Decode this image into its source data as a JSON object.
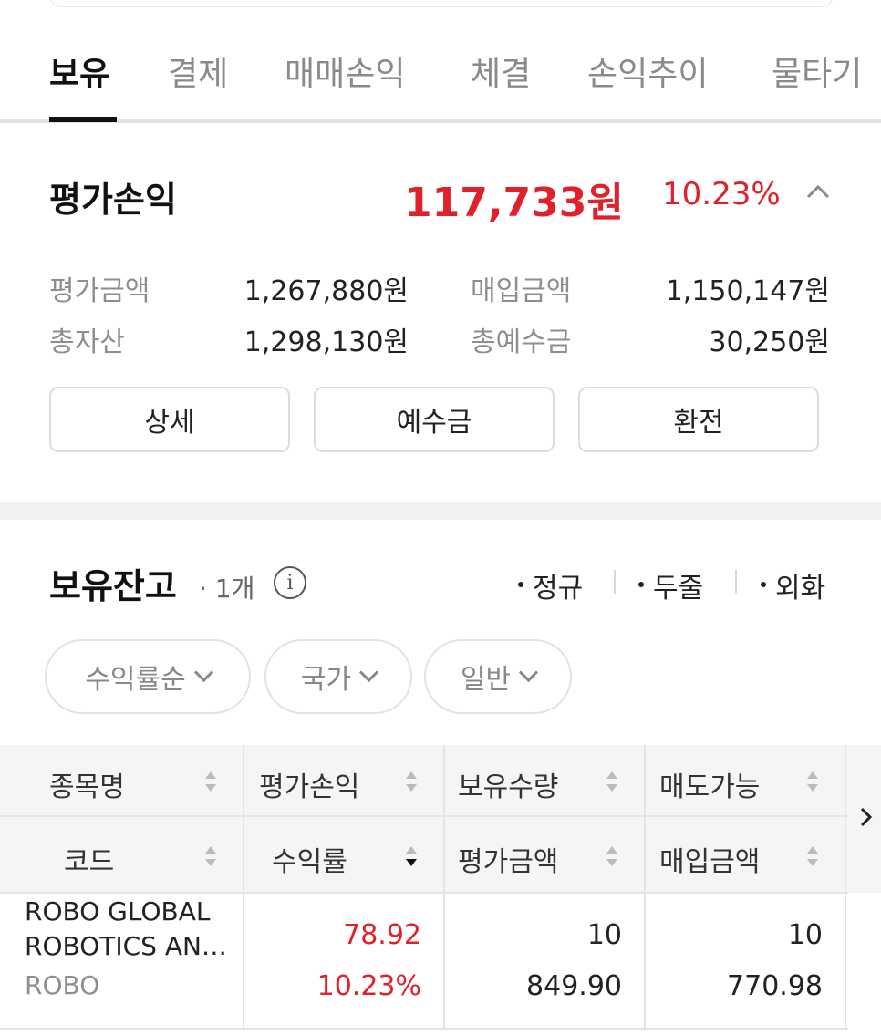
{
  "tabs": [
    "보유",
    "결제",
    "매매손익",
    "체결",
    "손익추이",
    "물타기"
  ],
  "summary": {
    "title": "평가손익",
    "amount": "117,733원",
    "rate": "10.23%",
    "rows": [
      {
        "label1": "평가금액",
        "value1": "1,267,880원",
        "label2": "매입금액",
        "value2": "1,150,147원"
      },
      {
        "label1": "총자산",
        "value1": "1,298,130원",
        "label2": "총예수금",
        "value2": "30,250원"
      }
    ],
    "buttons": [
      "상세",
      "예수금",
      "환전"
    ]
  },
  "holdings": {
    "title": "보유잔고",
    "count": "· 1개",
    "legend": [
      "정규",
      "두줄",
      "외화"
    ],
    "filters": [
      "수익률순",
      "국가",
      "일반"
    ],
    "header_row1": [
      "종목명",
      "평가손익",
      "보유수량",
      "매도가능"
    ],
    "header_row2": [
      "코드",
      "수익률",
      "평가금액",
      "매입금액"
    ],
    "rows": [
      {
        "name_line1": "ROBO GLOBAL",
        "name_line2": "ROBOTICS AN…",
        "code": "ROBO",
        "pnl": "78.92",
        "rate": "10.23%",
        "qty": "10",
        "eval_amount": "849.90",
        "sellable": "10",
        "buy_amount": "770.98"
      }
    ]
  },
  "colors": {
    "profit": "#e0202a",
    "text": "#222222",
    "muted": "#8e8e8e"
  },
  "icons": [
    "chevron-up-icon",
    "info-icon",
    "sort-icon",
    "sort-desc-icon",
    "chevron-down-icon",
    "chevron-right-icon"
  ]
}
